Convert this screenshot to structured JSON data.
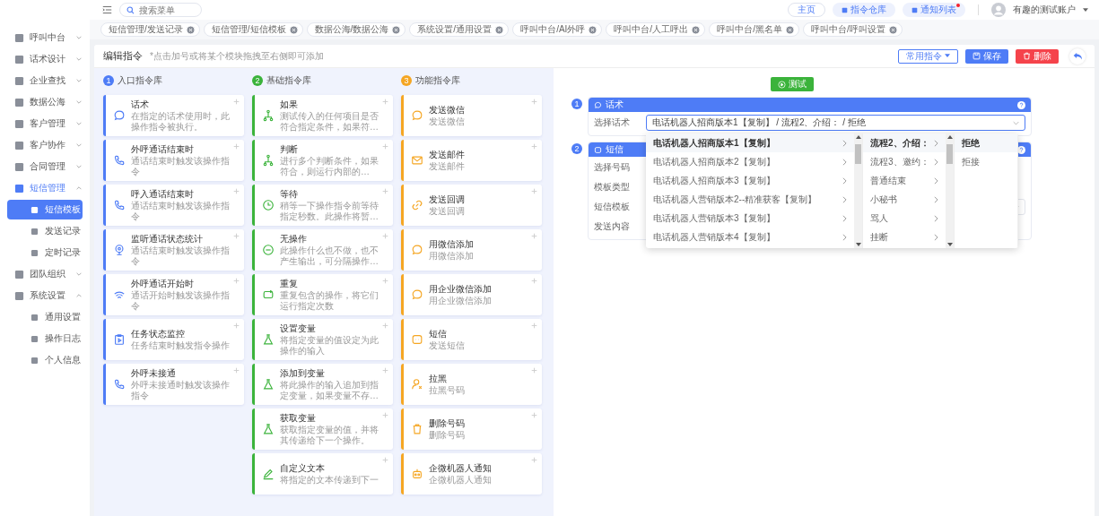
{
  "topbar": {
    "search": {
      "placeholder": "搜索菜单"
    },
    "buttons": [
      {
        "label": "主页",
        "kind": "outline",
        "badge": false
      },
      {
        "label": "指令仓库",
        "kind": "fill",
        "badge": false
      },
      {
        "label": "通知列表",
        "kind": "fill",
        "badge": true
      }
    ],
    "user": "有趣的测试账户"
  },
  "sidebar": {
    "items": [
      {
        "label": "呼叫中台",
        "expanded": false,
        "selected": false
      },
      {
        "label": "话术设计",
        "expanded": false,
        "selected": false
      },
      {
        "label": "企业查找",
        "expanded": false,
        "selected": false
      },
      {
        "label": "数据公海",
        "expanded": false,
        "selected": false
      },
      {
        "label": "客户管理",
        "expanded": false,
        "selected": false
      },
      {
        "label": "客户协作",
        "expanded": false,
        "selected": false
      },
      {
        "label": "合同管理",
        "expanded": false,
        "selected": false
      },
      {
        "label": "短信管理",
        "expanded": true,
        "selected": true,
        "children": [
          {
            "label": "短信模板",
            "selected": true
          },
          {
            "label": "发送记录",
            "selected": false
          },
          {
            "label": "定时记录",
            "selected": false
          }
        ]
      },
      {
        "label": "团队组织",
        "expanded": false,
        "selected": false
      },
      {
        "label": "系统设置",
        "expanded": true,
        "selected": false,
        "children": [
          {
            "label": "通用设置",
            "selected": false
          },
          {
            "label": "操作日志",
            "selected": false
          },
          {
            "label": "个人信息",
            "selected": false
          }
        ]
      }
    ]
  },
  "tabs": [
    {
      "label": "短信管理/发送记录"
    },
    {
      "label": "短信管理/短信模板"
    },
    {
      "label": "数据公海/数据公海"
    },
    {
      "label": "系统设置/通用设置"
    },
    {
      "label": "呼叫中台/AI外呼"
    },
    {
      "label": "呼叫中台/人工呼出"
    },
    {
      "label": "呼叫中台/黑名单"
    },
    {
      "label": "呼叫中台/呼叫设置"
    }
  ],
  "header": {
    "title": "编辑指令",
    "hint": "*点击加号或将某个模块拖拽至右侧即可添加",
    "buttons": [
      {
        "label": "常用指令",
        "kind": "dropdown"
      },
      {
        "label": "保存",
        "kind": "primary"
      },
      {
        "label": "删除",
        "kind": "danger"
      }
    ]
  },
  "libraries": [
    {
      "number": "1",
      "title": "入口指令库",
      "color": "#4e7cf6",
      "cards": [
        {
          "title": "话术",
          "desc": "在指定的话术使用时，此操作指令被执行。"
        },
        {
          "title": "外呼通话结束时",
          "desc": "通话结束时触发该操作指令"
        },
        {
          "title": "呼入通话结束时",
          "desc": "通话结束时触发该操作指令"
        },
        {
          "title": "监听通话状态统计",
          "desc": "通话结束时触发该操作指令"
        },
        {
          "title": "外呼通话开始时",
          "desc": "通话开始时触发该操作指令"
        },
        {
          "title": "任务状态监控",
          "desc": "任务结束时触发指令操作"
        },
        {
          "title": "外呼未接通",
          "desc": "外呼未接通时触发该操作指令"
        }
      ]
    },
    {
      "number": "2",
      "title": "基础指令库",
      "color": "#3bb33b",
      "cards": [
        {
          "title": "如果",
          "desc": "测试传入的任何项目是否符合指定条件，如果符…"
        },
        {
          "title": "判断",
          "desc": "进行多个判断条件，如果符合，则运行内部的…"
        },
        {
          "title": "等待",
          "desc": "稍等一下操作指令前等待指定秒数。此操作将暂…"
        },
        {
          "title": "无操作",
          "desc": "此操作什么也不做，也不产生输出，可分隔操作…"
        },
        {
          "title": "重复",
          "desc": "重复包含的操作，将它们运行指定次数"
        },
        {
          "title": "设置变量",
          "desc": "将指定变量的值设定为此操作的输入"
        },
        {
          "title": "添加到变量",
          "desc": "将此操作的输入追加到指定变量，如果变量不存…"
        },
        {
          "title": "获取变量",
          "desc": "获取指定变量的值，并将其传递给下一个操作。"
        },
        {
          "title": "自定义文本",
          "desc": "将指定的文本传递到下一"
        }
      ]
    },
    {
      "number": "3",
      "title": "功能指令库",
      "color": "#f5a623",
      "cards": [
        {
          "title": "发送微信",
          "desc": "发送微信"
        },
        {
          "title": "发送邮件",
          "desc": "发送邮件"
        },
        {
          "title": "发送回调",
          "desc": "发送回调"
        },
        {
          "title": "用微信添加",
          "desc": "用微信添加"
        },
        {
          "title": "用企业微信添加",
          "desc": "用企业微信添加"
        },
        {
          "title": "短信",
          "desc": "发送短信"
        },
        {
          "title": "拉黑",
          "desc": "拉黑号码"
        },
        {
          "title": "删除号码",
          "desc": "删除号码"
        },
        {
          "title": "企微机器人通知",
          "desc": "企微机器人通知"
        }
      ]
    }
  ],
  "editor": {
    "test_button": "测试",
    "steps": [
      {
        "number": "1",
        "title": "话术",
        "fields": [
          {
            "label": "选择话术",
            "kind": "select",
            "value": "电话机器人招商版本1【复制】 / 流程2、介绍： / 拒绝"
          }
        ]
      },
      {
        "number": "2",
        "title": "短信",
        "fields": [
          {
            "label": "选择号码",
            "kind": "plain"
          },
          {
            "label": "模板类型",
            "kind": "plain"
          },
          {
            "label": "短信模板",
            "kind": "select"
          },
          {
            "label": "发送内容",
            "kind": "plain"
          }
        ]
      }
    ],
    "cascader": {
      "columns": [
        {
          "scroll": true,
          "items": [
            {
              "label": "电话机器人招商版本1【复制】",
              "selected": true,
              "arrow": true
            },
            {
              "label": "电话机器人招商版本2【复制】",
              "selected": false,
              "arrow": true
            },
            {
              "label": "电话机器人招商版本3【复制】",
              "selected": false,
              "arrow": true
            },
            {
              "label": "电话机器人营销版本2--精准获客【复制】",
              "selected": false,
              "arrow": true
            },
            {
              "label": "电话机器人营销版本3【复制】",
              "selected": false,
              "arrow": true
            },
            {
              "label": "电话机器人营销版本4【复制】",
              "selected": false,
              "arrow": true
            }
          ]
        },
        {
          "scroll": true,
          "items": [
            {
              "label": "流程2、介绍：",
              "selected": true,
              "arrow": true
            },
            {
              "label": "流程3、邀约：",
              "selected": false,
              "arrow": true
            },
            {
              "label": "普通结束",
              "selected": false,
              "arrow": true
            },
            {
              "label": "小秘书",
              "selected": false,
              "arrow": true
            },
            {
              "label": "骂人",
              "selected": false,
              "arrow": true
            },
            {
              "label": "挂断",
              "selected": false,
              "arrow": true
            }
          ]
        },
        {
          "scroll": false,
          "items": [
            {
              "label": "拒绝",
              "selected": true,
              "arrow": false
            },
            {
              "label": "拒接",
              "selected": false,
              "arrow": false
            }
          ]
        }
      ]
    }
  }
}
